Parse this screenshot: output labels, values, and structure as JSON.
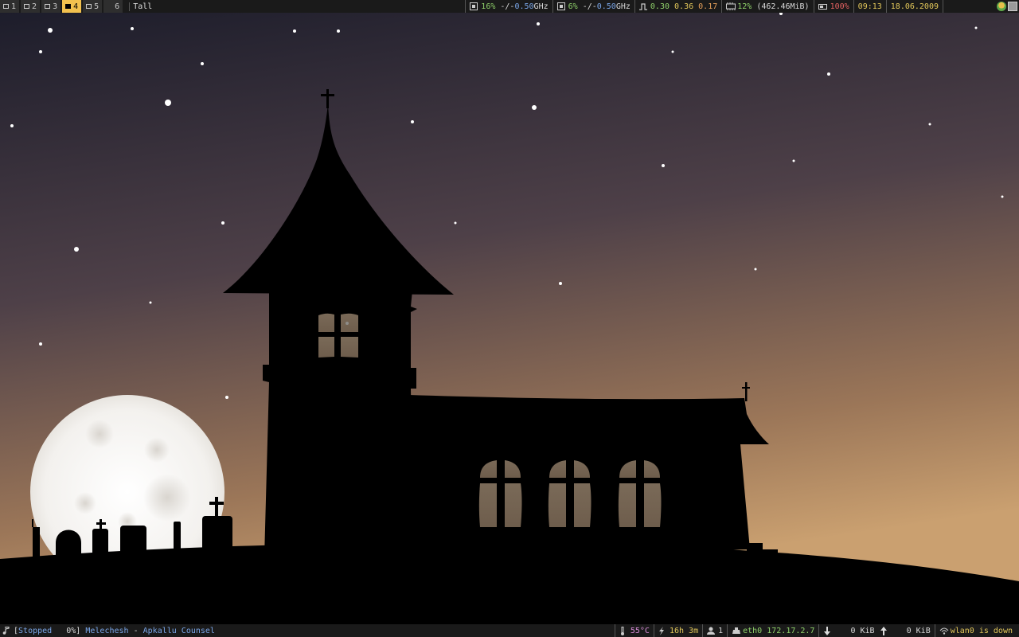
{
  "topbar": {
    "workspaces": [
      {
        "num": "1",
        "active": false
      },
      {
        "num": "2",
        "active": false
      },
      {
        "num": "3",
        "active": false
      },
      {
        "num": "4",
        "active": true
      },
      {
        "num": "5",
        "active": false
      },
      {
        "num": "6",
        "active": false
      }
    ],
    "layout": "Tall",
    "cpu1": {
      "pct": "16%",
      "sep": "-/-",
      "freq": "0.50",
      "unit": "GHz"
    },
    "cpu2": {
      "pct": "6%",
      "sep": "-/-",
      "freq": "0.50",
      "unit": "GHz"
    },
    "load": {
      "l1": "0.30",
      "l5": "0.36",
      "l15": "0.17"
    },
    "mem": {
      "pct": "12%",
      "used": "(462.46MiB)"
    },
    "battery": "100%",
    "time": "09:13",
    "date": "18.06.2009"
  },
  "bottombar": {
    "mpd": {
      "open": "[",
      "status": "Stopped",
      "pct": "0%",
      "close": "]",
      "artist": "Melechesh",
      "dash": "-",
      "track": "Apkallu Counsel"
    },
    "temp": "55°C",
    "uptime": "16h 3m",
    "users": "1",
    "eth": {
      "iface": "eth0",
      "ip": "172.17.2.7"
    },
    "down": "0 KiB",
    "up": "0 KiB",
    "wlan": "wlan0 is down"
  },
  "icons": {
    "cpu": "chip-icon",
    "load": "load-icon",
    "mem": "memory-icon",
    "battery": "battery-icon",
    "music": "music-note-icon",
    "temp": "thermometer-icon",
    "uptime": "lightning-icon",
    "user": "user-icon",
    "net": "network-icon",
    "down": "arrow-down-icon",
    "up": "arrow-up-icon",
    "wifi": "wifi-icon"
  },
  "colors": {
    "accent": "#f2c14e",
    "bar_bg": "#1a1a1a",
    "sky_top": "#1d1d2b",
    "sky_bottom": "#c49a6a"
  }
}
